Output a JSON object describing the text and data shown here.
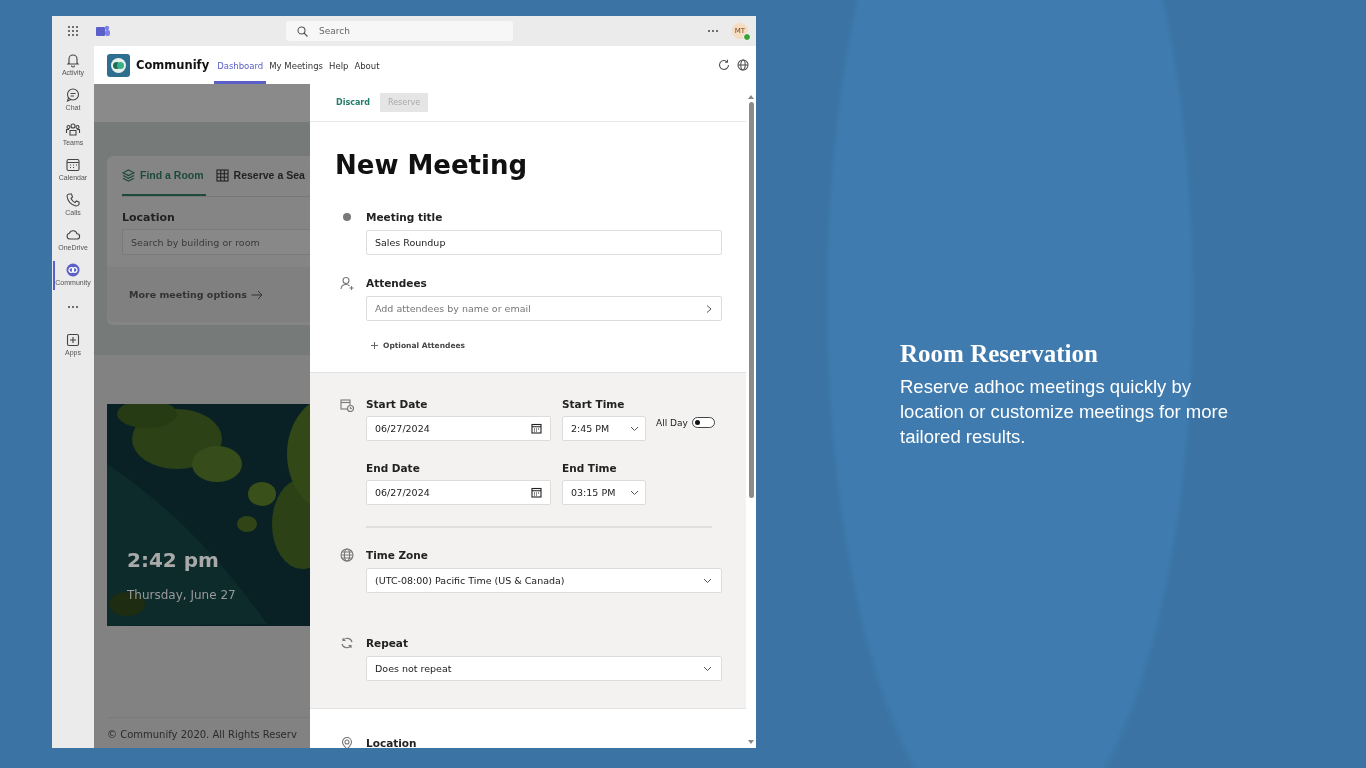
{
  "teams": {
    "search_placeholder": "Search",
    "avatar": "MT",
    "rail": [
      {
        "label": "Activity",
        "selected": false
      },
      {
        "label": "Chat",
        "selected": false
      },
      {
        "label": "Teams",
        "selected": false
      },
      {
        "label": "Calendar",
        "selected": false
      },
      {
        "label": "Calls",
        "selected": false
      },
      {
        "label": "OneDrive",
        "selected": false
      },
      {
        "label": "Community",
        "selected": true
      }
    ],
    "apps_label": "Apps"
  },
  "app": {
    "name": "Communify",
    "tabs": [
      {
        "label": "Dashboard",
        "selected": true
      },
      {
        "label": "My Meetings",
        "selected": false
      },
      {
        "label": "Help",
        "selected": false
      },
      {
        "label": "About",
        "selected": false
      }
    ]
  },
  "dashboard": {
    "tabs": [
      {
        "label": "Find a Room",
        "selected": true
      },
      {
        "label": "Reserve a Sea",
        "selected": false
      }
    ],
    "location_label": "Location",
    "location_placeholder": "Search by building or room",
    "more_options": "More meeting options",
    "time": "2:42 pm",
    "date": "Thursday, June 27",
    "footer": "© Communify 2020. All Rights Reserv"
  },
  "panel": {
    "actions": [
      {
        "label": "Discard",
        "disabled": false
      },
      {
        "label": "Reserve",
        "disabled": true
      }
    ],
    "title": "New Meeting",
    "meeting_title": {
      "label": "Meeting title",
      "value": "Sales Roundup"
    },
    "attendees": {
      "label": "Attendees",
      "placeholder": "Add attendees by name or email",
      "optional": "Optional Attendees"
    },
    "start_date": {
      "label": "Start Date",
      "value": "06/27/2024"
    },
    "start_time": {
      "label": "Start Time",
      "value": "2:45 PM"
    },
    "all_day": {
      "label": "All Day",
      "on": false
    },
    "end_date": {
      "label": "End Date",
      "value": "06/27/2024"
    },
    "end_time": {
      "label": "End Time",
      "value": "03:15 PM"
    },
    "time_zone": {
      "label": "Time Zone",
      "value": "(UTC-08:00) Pacific Time (US & Canada)"
    },
    "repeat": {
      "label": "Repeat",
      "value": "Does not repeat"
    },
    "location": {
      "label": "Location"
    }
  },
  "slide": {
    "heading": "Room Reservation",
    "text": "Reserve adhoc meetings quickly by location or customize meetings for more tailored results."
  }
}
